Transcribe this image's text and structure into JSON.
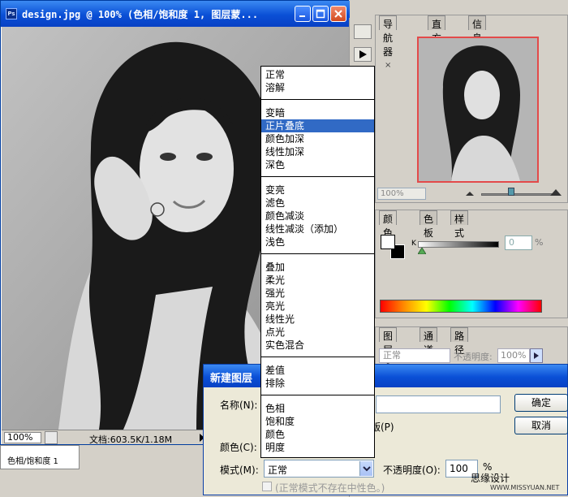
{
  "doc_window": {
    "title": "design.jpg @ 100% (色相/饱和度 1, 图层蒙...",
    "zoom": "100%",
    "doc_info": "文档:603.5K/1.18M"
  },
  "layer_strip_label": "色相/饱和度 1",
  "navigator": {
    "tabs": [
      "导航器",
      "直方图",
      "信息"
    ],
    "zoom": "100%"
  },
  "color_palette": {
    "tabs": [
      "颜色",
      "色板",
      "样式"
    ],
    "channel_label": "K",
    "k_value": "0",
    "pct": "%"
  },
  "layers_palette": {
    "tabs": [
      "图层",
      "通道",
      "路径"
    ],
    "blend_mode": "正常",
    "opacity_label": "不透明度:",
    "opacity_value": "100%"
  },
  "dialog": {
    "title": "新建图层",
    "name_label": "名称(N):",
    "clip_label": "使用前一图层创建剪贴蒙版(P)",
    "clip_visible": "版(P)",
    "color_label": "颜色(C):",
    "mode_label": "模式(M):",
    "mode_value": "正常",
    "opacity_label": "不透明度(O):",
    "opacity_value": "100",
    "pct": "%",
    "ok_label": "确定",
    "cancel_label": "取消",
    "note": "(正常模式不存在中性色。)"
  },
  "blend_menu": {
    "groups": [
      [
        "正常",
        "溶解"
      ],
      [
        "变暗",
        "正片叠底",
        "颜色加深",
        "线性加深",
        "深色"
      ],
      [
        "变亮",
        "滤色",
        "颜色减淡",
        "线性减淡（添加）",
        "浅色"
      ],
      [
        "叠加",
        "柔光",
        "强光",
        "亮光",
        "线性光",
        "点光",
        "实色混合"
      ],
      [
        "差值",
        "排除"
      ],
      [
        "色相",
        "饱和度",
        "颜色",
        "明度"
      ]
    ],
    "selected": "正片叠底"
  },
  "watermark": {
    "text": "思缘设计",
    "url": "WWW.MISSYUAN.NET"
  },
  "colors": {
    "titlebar": "#0a4fd6",
    "menu_highlight": "#316ac5",
    "nav_frame": "#e34a4a"
  }
}
